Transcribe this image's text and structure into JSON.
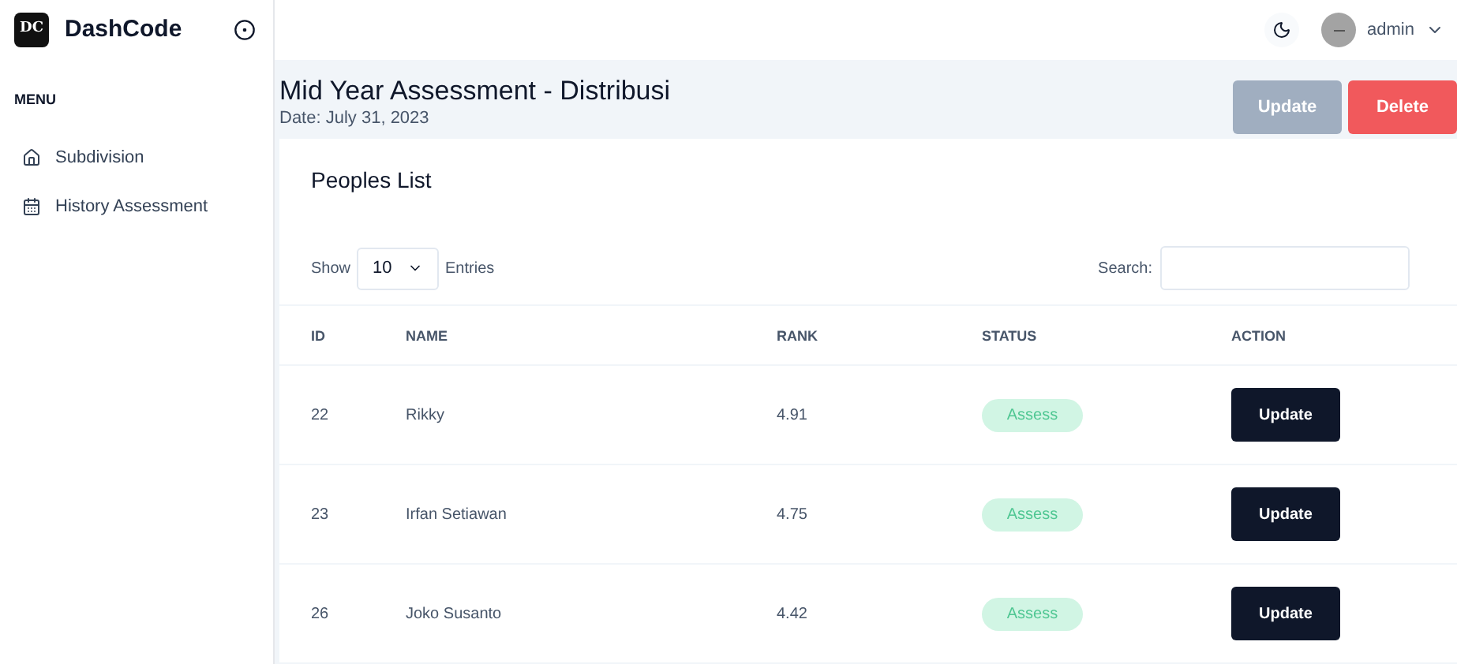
{
  "brand": {
    "mark": "DC",
    "name": "DashCode"
  },
  "sidebar": {
    "heading": "MENU",
    "items": [
      {
        "label": "Subdivision"
      },
      {
        "label": "History Assessment"
      }
    ]
  },
  "header": {
    "user": "admin"
  },
  "page": {
    "title": "Mid Year Assessment - Distribusi",
    "date": "Date: July 31, 2023",
    "buttons": [
      {
        "label": "Update",
        "kind": "muted"
      },
      {
        "label": "Delete",
        "kind": "danger"
      }
    ]
  },
  "card": {
    "title": "Peoples List",
    "show_label": "Show",
    "page_size": "10",
    "entries_label": "Entries",
    "search_label": "Search:"
  },
  "table": {
    "columns": [
      "ID",
      "NAME",
      "RANK",
      "STATUS",
      "ACTION"
    ],
    "rows": [
      {
        "id": "22",
        "name": "Rikky",
        "rank": "4.91",
        "status": "Assess",
        "action": "Update"
      },
      {
        "id": "23",
        "name": "Irfan Setiawan",
        "rank": "4.75",
        "status": "Assess",
        "action": "Update"
      },
      {
        "id": "26",
        "name": "Joko Susanto",
        "rank": "4.42",
        "status": "Assess",
        "action": "Update"
      }
    ]
  }
}
